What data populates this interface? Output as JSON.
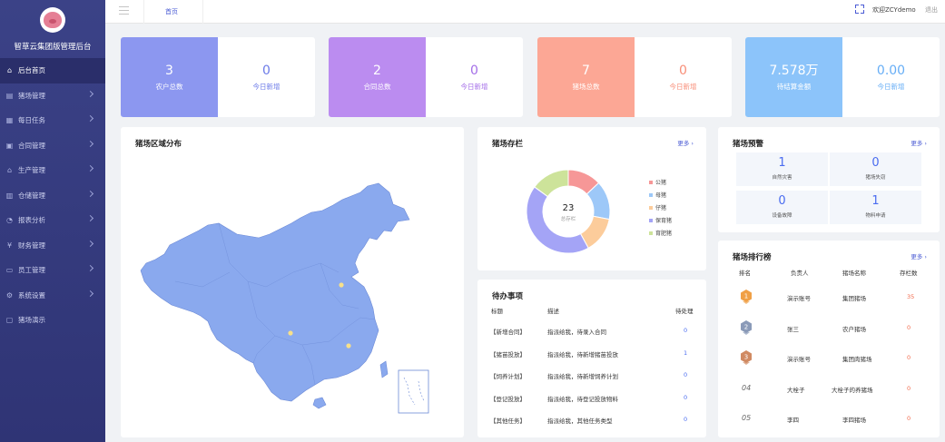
{
  "app": {
    "title": "智草云集团版管理后台",
    "logo_icon": "pig-logo-icon"
  },
  "sidebar": {
    "items": [
      {
        "label": "后台首页",
        "icon": "home-icon",
        "active": true
      },
      {
        "label": "猪场管理",
        "icon": "farm-icon"
      },
      {
        "label": "每日任务",
        "icon": "calendar-icon"
      },
      {
        "label": "合同管理",
        "icon": "document-icon"
      },
      {
        "label": "生产管理",
        "icon": "factory-icon"
      },
      {
        "label": "仓储管理",
        "icon": "warehouse-icon"
      },
      {
        "label": "报表分析",
        "icon": "chart-icon"
      },
      {
        "label": "财务管理",
        "icon": "finance-icon"
      },
      {
        "label": "员工管理",
        "icon": "employee-icon"
      },
      {
        "label": "系统设置",
        "icon": "settings-icon"
      },
      {
        "label": "猪场演示",
        "icon": "demo-icon"
      }
    ]
  },
  "header": {
    "tab": "首页",
    "welcome": "欢迎ZCYdemo",
    "logout": "退出"
  },
  "stats": [
    {
      "value": "3",
      "label": "农户总数",
      "today_value": "0",
      "today_label": "今日新增",
      "color": "#8c97f0",
      "text_color": "#6c7be8"
    },
    {
      "value": "2",
      "label": "合同总数",
      "today_value": "0",
      "today_label": "今日新增",
      "color": "#bb8cf0",
      "text_color": "#a46ee8"
    },
    {
      "value": "7",
      "label": "猪场总数",
      "today_value": "0",
      "today_label": "今日新增",
      "color": "#fca795",
      "text_color": "#f88e78"
    },
    {
      "value": "7.578万",
      "label": "待结算金额",
      "today_value": "0.00",
      "today_label": "今日新增",
      "color": "#8cc4fa",
      "text_color": "#67aef6"
    }
  ],
  "map_panel": {
    "title": "猪场区域分布",
    "map_color": "#8aa9ee"
  },
  "stock": {
    "title": "猪场存栏",
    "more": "更多 ›",
    "total": "23",
    "total_label": "总存栏",
    "legend": [
      {
        "name": "公猪",
        "color": "#f69797"
      },
      {
        "name": "母猪",
        "color": "#9dc8f8"
      },
      {
        "name": "仔猪",
        "color": "#fccc9b"
      },
      {
        "name": "保育猪",
        "color": "#a4a4f6"
      },
      {
        "name": "育肥猪",
        "color": "#cde39a"
      }
    ]
  },
  "todo": {
    "title": "待办事项",
    "columns": [
      "标题",
      "描述",
      "待处理"
    ],
    "rows": [
      {
        "title": "【新增合同】",
        "desc": "指派给我，待录入合同",
        "count": "0"
      },
      {
        "title": "【猪苗投放】",
        "desc": "指派给我，待新增猪苗投放",
        "count": "1"
      },
      {
        "title": "【饲养计划】",
        "desc": "指派给我，待新增饲养计划",
        "count": "0"
      },
      {
        "title": "【登记投放】",
        "desc": "指派给我，待登记投放物料",
        "count": "0"
      },
      {
        "title": "【其他任务】",
        "desc": "指派给我，其他任务类型",
        "count": "0"
      }
    ]
  },
  "warning": {
    "title": "猪场预警",
    "more": "更多 ›",
    "items": [
      {
        "value": "1",
        "label": "自然灾害"
      },
      {
        "value": "0",
        "label": "猪场失窃"
      },
      {
        "value": "0",
        "label": "设备故障"
      },
      {
        "value": "1",
        "label": "物料申请"
      }
    ]
  },
  "rank": {
    "title": "猪场排行榜",
    "more": "更多 ›",
    "columns": [
      "排名",
      "负责人",
      "猪场名称",
      "存栏数"
    ],
    "rows": [
      {
        "rank": "1",
        "owner": "演示账号",
        "farm": "集团猪场",
        "stock": "35"
      },
      {
        "rank": "2",
        "owner": "张三",
        "farm": "农户猪场",
        "stock": "0"
      },
      {
        "rank": "3",
        "owner": "演示账号",
        "farm": "集团肉猪场",
        "stock": "0"
      },
      {
        "rank": "04",
        "owner": "大栓子",
        "farm": "大栓子的养猪场",
        "stock": "0"
      },
      {
        "rank": "05",
        "owner": "李四",
        "farm": "李四猪场",
        "stock": "0"
      }
    ]
  }
}
